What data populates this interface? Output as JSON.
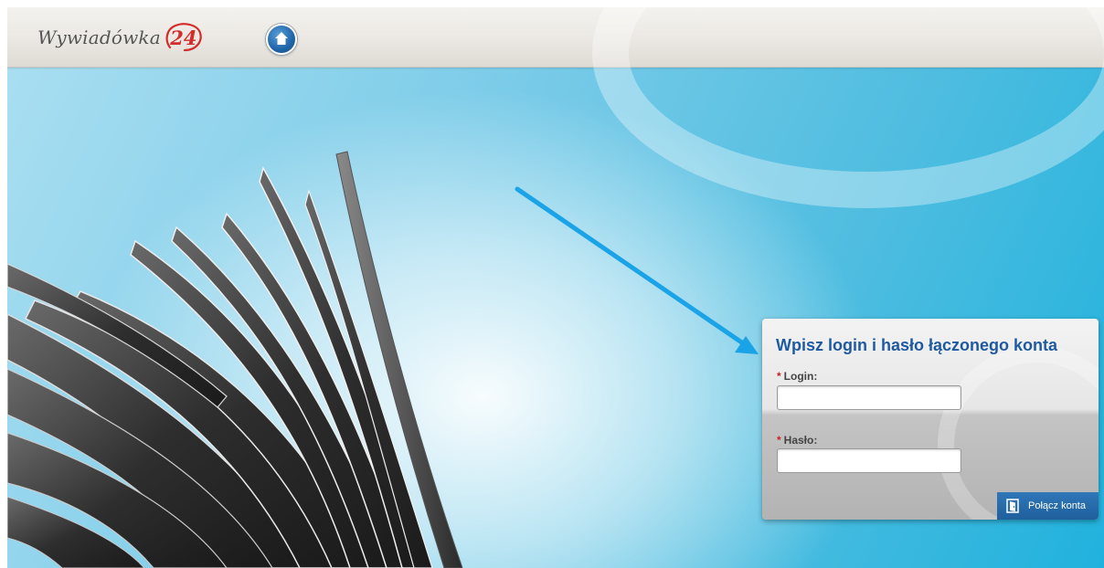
{
  "header": {
    "logo_text": "Wywiadówka",
    "logo_number": "24",
    "home_icon": "home-icon"
  },
  "login_panel": {
    "title": "Wpisz login i hasło łączonego konta",
    "login_label": "Login:",
    "password_label": "Hasło:",
    "required_marker": "*",
    "login_value": "",
    "password_value": "",
    "submit_label": "Połącz konta",
    "submit_icon": "door-icon"
  },
  "colors": {
    "accent": "#1f5aa0",
    "logo_red": "#d42b2b",
    "arrow": "#1aa3e6",
    "button": "#1f5f9c"
  }
}
